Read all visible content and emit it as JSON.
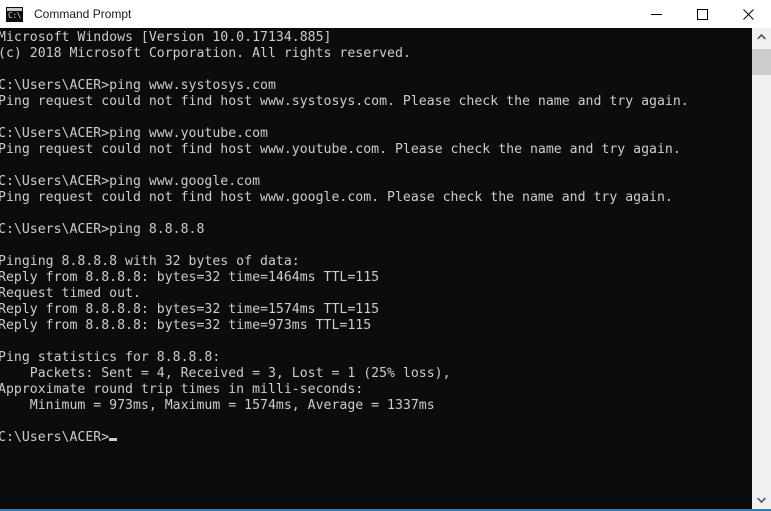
{
  "window": {
    "title": "Command Prompt",
    "icon": "command-prompt-icon",
    "icon_glyph": "C:\\",
    "background": "#0c0c0c",
    "foreground": "#cccccc",
    "focus_border_color": "#1883d7"
  },
  "titlebar": {
    "minimize_label": "—",
    "maximize_label": "□",
    "close_label": "✕"
  },
  "scrollbar": {
    "up_arrow": "▲",
    "down_arrow": "▼"
  },
  "console": {
    "prompt": "C:\\Users\\ACER>",
    "lines": [
      "Microsoft Windows [Version 10.0.17134.885]",
      "(c) 2018 Microsoft Corporation. All rights reserved.",
      "",
      "C:\\Users\\ACER>ping www.systosys.com",
      "Ping request could not find host www.systosys.com. Please check the name and try again.",
      "",
      "C:\\Users\\ACER>ping www.youtube.com",
      "Ping request could not find host www.youtube.com. Please check the name and try again.",
      "",
      "C:\\Users\\ACER>ping www.google.com",
      "Ping request could not find host www.google.com. Please check the name and try again.",
      "",
      "C:\\Users\\ACER>ping 8.8.8.8",
      "",
      "Pinging 8.8.8.8 with 32 bytes of data:",
      "Reply from 8.8.8.8: bytes=32 time=1464ms TTL=115",
      "Request timed out.",
      "Reply from 8.8.8.8: bytes=32 time=1574ms TTL=115",
      "Reply from 8.8.8.8: bytes=32 time=973ms TTL=115",
      "",
      "Ping statistics for 8.8.8.8:",
      "    Packets: Sent = 4, Received = 3, Lost = 1 (25% loss),",
      "Approximate round trip times in milli-seconds:",
      "    Minimum = 973ms, Maximum = 1574ms, Average = 1337ms",
      "",
      "C:\\Users\\ACER>"
    ],
    "cursor_line_index": 25,
    "commands": [
      {
        "command": "ping www.systosys.com",
        "result": "host not found"
      },
      {
        "command": "ping www.youtube.com",
        "result": "host not found"
      },
      {
        "command": "ping www.google.com",
        "result": "host not found"
      },
      {
        "command": "ping 8.8.8.8",
        "result": "3 replies, 1 timeout"
      }
    ],
    "ping_summary": {
      "target": "8.8.8.8",
      "bytes": 32,
      "sent": 4,
      "received": 3,
      "lost": 1,
      "loss_percent": "25%",
      "minimum_ms": 973,
      "maximum_ms": 1574,
      "average_ms": 1337,
      "ttl": 115,
      "reply_times_ms": [
        1464,
        1574,
        973
      ]
    }
  }
}
